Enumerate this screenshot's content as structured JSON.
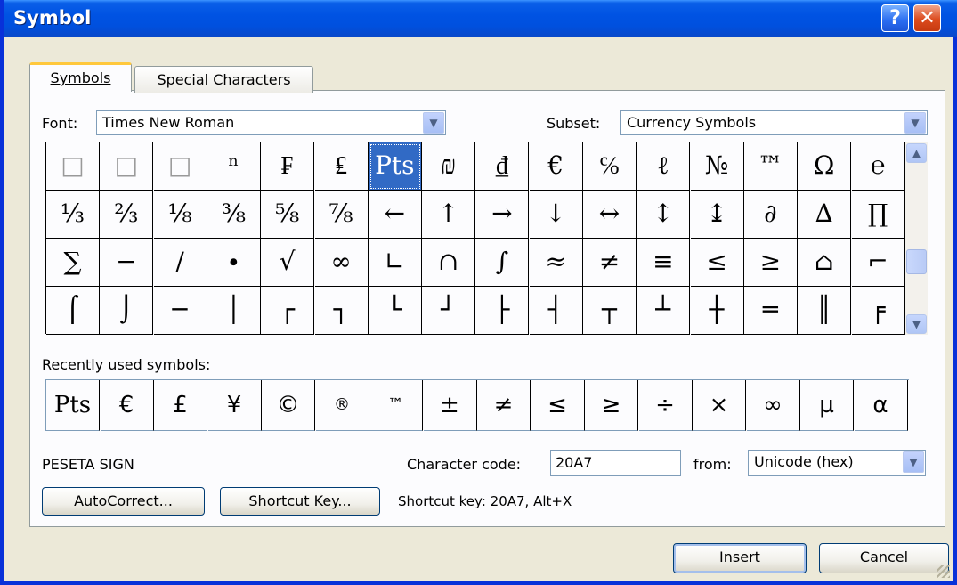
{
  "window": {
    "title": "Symbol",
    "help_label": "?",
    "close_label": "✕"
  },
  "tabs": [
    {
      "label": "Symbols",
      "active": true
    },
    {
      "label": "Special Characters",
      "active": false
    }
  ],
  "font": {
    "label": "Font:",
    "value": "Times New Roman"
  },
  "subset": {
    "label": "Subset:",
    "value": "Currency Symbols"
  },
  "symbol_grid": [
    [
      "□",
      "□",
      "□",
      "ⁿ",
      "₣",
      "₤",
      "Pts",
      "₪",
      "₫",
      "€",
      "℅",
      "ℓ",
      "№",
      "™",
      "Ω",
      "℮"
    ],
    [
      "⅓",
      "⅔",
      "⅛",
      "⅜",
      "⅝",
      "⅞",
      "←",
      "↑",
      "→",
      "↓",
      "↔",
      "↕",
      "↨",
      "∂",
      "∆",
      "∏"
    ],
    [
      "∑",
      "−",
      "∕",
      "∙",
      "√",
      "∞",
      "∟",
      "∩",
      "∫",
      "≈",
      "≠",
      "≡",
      "≤",
      "≥",
      "⌂",
      "⌐"
    ],
    [
      "⌠",
      "⌡",
      "─",
      "│",
      "┌",
      "┐",
      "└",
      "┘",
      "├",
      "┤",
      "┬",
      "┴",
      "┼",
      "═",
      "║",
      "╒"
    ]
  ],
  "selected_symbol": "Pts",
  "recent": {
    "label": "Recently used symbols:",
    "symbols": [
      "Pts",
      "€",
      "£",
      "¥",
      "©",
      "®",
      "™",
      "±",
      "≠",
      "≤",
      "≥",
      "÷",
      "×",
      "∞",
      "µ",
      "α"
    ]
  },
  "char_name": "PESETA SIGN",
  "char_code": {
    "label": "Character code:",
    "value": "20A7"
  },
  "from": {
    "label": "from:",
    "value": "Unicode (hex)"
  },
  "buttons": {
    "autocorrect": "AutoCorrect...",
    "shortcut_key": "Shortcut Key...",
    "insert": "Insert",
    "cancel": "Cancel"
  },
  "shortcut_text": "Shortcut key: 20A7, Alt+X",
  "icons": {
    "dropdown": "chevron-down-icon",
    "scroll_up": "chevron-up-icon",
    "scroll_down": "chevron-down-icon"
  },
  "colors": {
    "title_bar": "#0054e3",
    "selection": "#316ac5",
    "dialog_bg": "#ece9d8",
    "tab_accent": "#ffc83c"
  }
}
